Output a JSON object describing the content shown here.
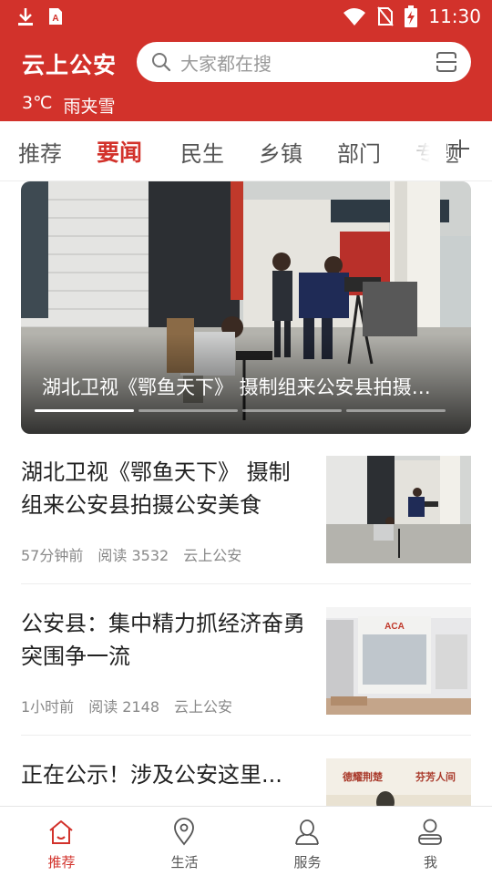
{
  "status_bar": {
    "time": "11:30"
  },
  "header": {
    "app_title": "云上公安",
    "search_placeholder": "大家都在搜",
    "weather": {
      "temperature": "3℃",
      "condition": "雨夹雪"
    }
  },
  "tabs": [
    {
      "label": "推荐"
    },
    {
      "label": "要闻"
    },
    {
      "label": "民生"
    },
    {
      "label": "乡镇"
    },
    {
      "label": "部门"
    },
    {
      "label": "专题"
    }
  ],
  "active_tab": "要闻",
  "banner": {
    "caption": "湖北卫视《鄂鱼天下》 摄制组来公安县拍摄公安美食",
    "slide_count": 4,
    "active_slide": 1
  },
  "news": [
    {
      "title": "湖北卫视《鄂鱼天下》 摄制组来公安县拍摄公安美食",
      "time": "57分钟前",
      "reads": "阅读 3532",
      "source": "云上公安"
    },
    {
      "title": "公安县：集中精力抓经济奋勇突围争一流",
      "time": "1小时前",
      "reads": "阅读 2148",
      "source": "云上公安"
    },
    {
      "title": "正在公示！涉及公安这里..."
    }
  ],
  "thumb_text": {
    "sign": "ACA",
    "banner_left": "德耀荆楚",
    "banner_right": "芬芳人间"
  },
  "bottom_nav": [
    {
      "label": "推荐",
      "icon": "home-icon"
    },
    {
      "label": "生活",
      "icon": "location-pin-icon"
    },
    {
      "label": "服务",
      "icon": "user-service-icon"
    },
    {
      "label": "我",
      "icon": "profile-icon"
    }
  ],
  "colors": {
    "brand": "#d2322b",
    "text": "#222222",
    "meta": "#888888",
    "inactive_nav": "#555555"
  }
}
